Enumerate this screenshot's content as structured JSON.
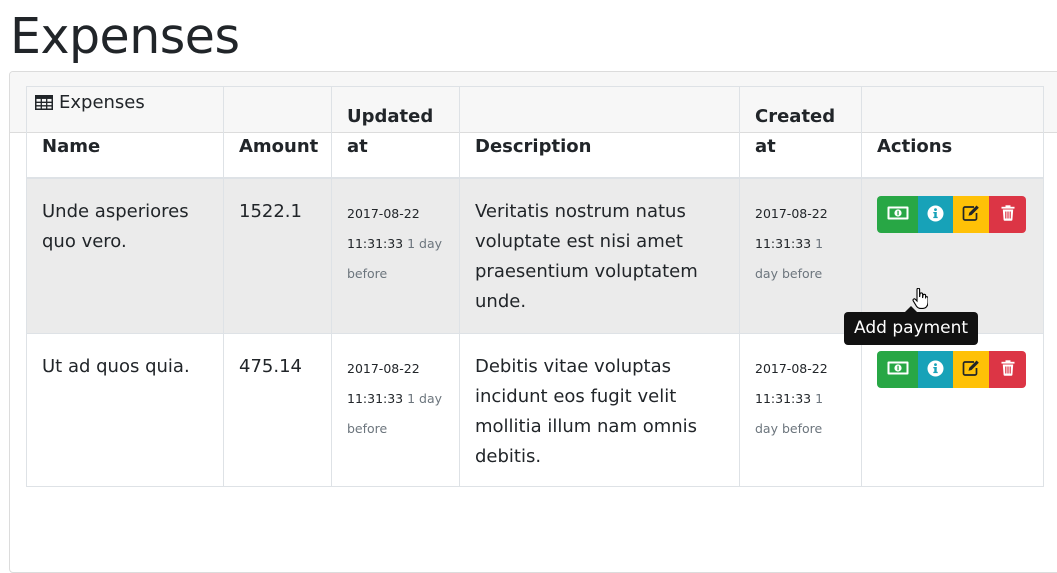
{
  "page": {
    "title": "Expenses"
  },
  "card": {
    "header_label": "Expenses",
    "header_icon": "table-icon"
  },
  "table": {
    "columns": [
      "Name",
      "Amount",
      "Updated\nat",
      "Description",
      "Created\nat",
      "Actions"
    ],
    "rows": [
      {
        "name": "Unde asperiores quo vero.",
        "amount": "1522.1",
        "updated_date": "2017-08-22",
        "updated_time": "11:31:33",
        "updated_rel": "1 day before",
        "description": "Veritatis nostrum natus voluptate est nisi amet praesentium voluptatem unde.",
        "created_date": "2017-08-22",
        "created_time": "11:31:33",
        "created_rel": "1 day before"
      },
      {
        "name": "Ut ad quos quia.",
        "amount": "475.14",
        "updated_date": "2017-08-22",
        "updated_time": "11:31:33",
        "updated_rel": "1 day before",
        "description": "Debitis vitae voluptas incidunt eos fugit velit mollitia illum nam omnis debitis.",
        "created_date": "2017-08-22",
        "created_time": "11:31:33",
        "created_rel": "1 day before"
      }
    ]
  },
  "actions": [
    {
      "name": "add-payment",
      "icon": "money-bill-icon",
      "color": "#28a745"
    },
    {
      "name": "info",
      "icon": "info-circle-icon",
      "color": "#17a2b8"
    },
    {
      "name": "edit",
      "icon": "edit-icon",
      "color": "#ffc107"
    },
    {
      "name": "delete",
      "icon": "trash-icon",
      "color": "#dc3545"
    }
  ],
  "tooltip": {
    "text": "Add payment"
  }
}
